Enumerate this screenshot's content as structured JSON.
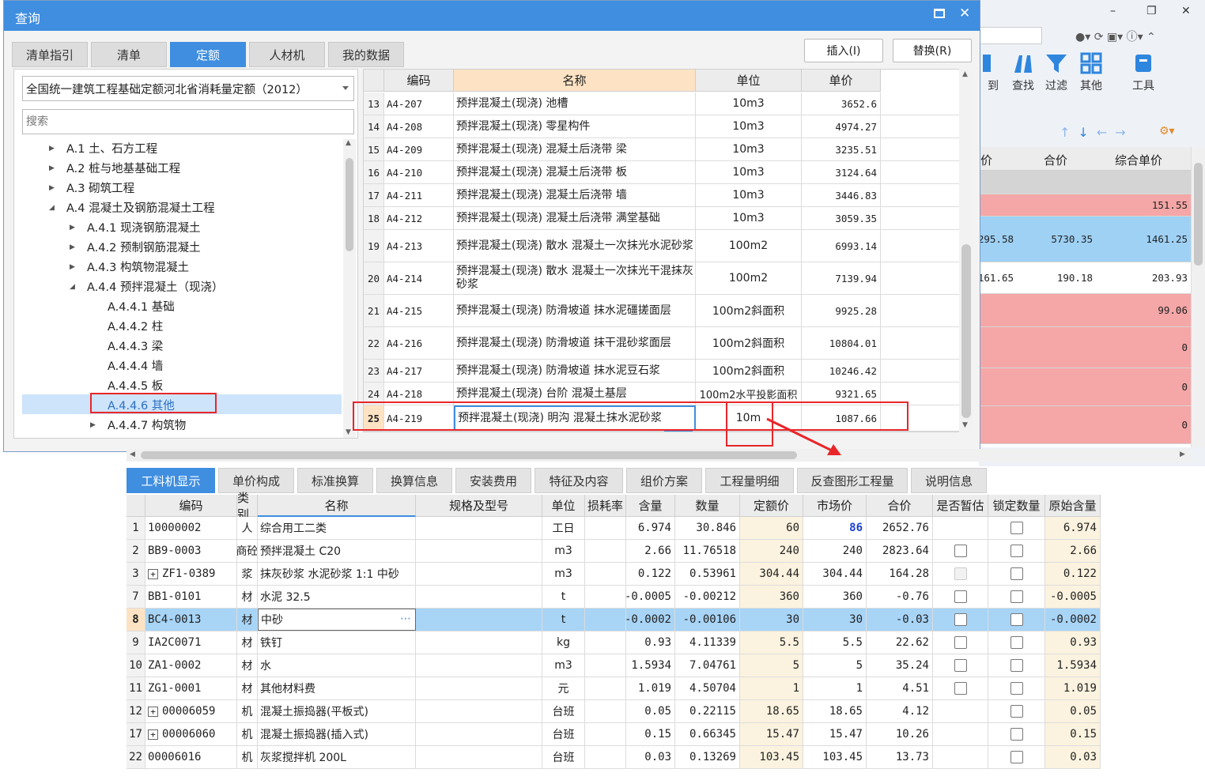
{
  "dialog": {
    "title": "查询",
    "tabs": [
      "清单指引",
      "清单",
      "定额",
      "人材机",
      "我的数据"
    ],
    "active_tab": "定额",
    "insert_btn": "插入(I)",
    "replace_btn": "替换(R)",
    "library": "全国统一建筑工程基础定额河北省消耗量定额（2012）",
    "search_placeholder": "搜索",
    "tree": [
      {
        "label": "A.1 土、石方工程",
        "level": 0,
        "state": "collapsed"
      },
      {
        "label": "A.2 桩与地基基础工程",
        "level": 0,
        "state": "collapsed"
      },
      {
        "label": "A.3 砌筑工程",
        "level": 0,
        "state": "collapsed"
      },
      {
        "label": "A.4 混凝土及钢筋混凝土工程",
        "level": 0,
        "state": "expanded"
      },
      {
        "label": "A.4.1 现浇钢筋混凝土",
        "level": 1,
        "state": "collapsed"
      },
      {
        "label": "A.4.2 预制钢筋混凝土",
        "level": 1,
        "state": "collapsed"
      },
      {
        "label": "A.4.3 构筑物混凝土",
        "level": 1,
        "state": "collapsed"
      },
      {
        "label": "A.4.4 预拌混凝土（现浇）",
        "level": 1,
        "state": "expanded"
      },
      {
        "label": "A.4.4.1 基础",
        "level": 2,
        "state": "leaf"
      },
      {
        "label": "A.4.4.2 柱",
        "level": 2,
        "state": "leaf"
      },
      {
        "label": "A.4.4.3 梁",
        "level": 2,
        "state": "leaf"
      },
      {
        "label": "A.4.4.4 墙",
        "level": 2,
        "state": "leaf"
      },
      {
        "label": "A.4.4.5 板",
        "level": 2,
        "state": "leaf"
      },
      {
        "label": "A.4.4.6 其他",
        "level": 2,
        "state": "selected"
      },
      {
        "label": "A.4.4.7 构筑物",
        "level": 2,
        "state": "collapsed"
      }
    ],
    "grid_headers": [
      "编码",
      "名称",
      "单位",
      "单价"
    ],
    "grid_rows": [
      {
        "no": "13",
        "code": "A4-207",
        "name": "预拌混凝土(现浇) 池槽",
        "unit": "10m3",
        "price": "3652.6"
      },
      {
        "no": "14",
        "code": "A4-208",
        "name": "预拌混凝土(现浇) 零星构件",
        "unit": "10m3",
        "price": "4974.27"
      },
      {
        "no": "15",
        "code": "A4-209",
        "name": "预拌混凝土(现浇) 混凝土后浇带 梁",
        "unit": "10m3",
        "price": "3235.51"
      },
      {
        "no": "16",
        "code": "A4-210",
        "name": "预拌混凝土(现浇) 混凝土后浇带 板",
        "unit": "10m3",
        "price": "3124.64"
      },
      {
        "no": "17",
        "code": "A4-211",
        "name": "预拌混凝土(现浇) 混凝土后浇带 墙",
        "unit": "10m3",
        "price": "3446.83"
      },
      {
        "no": "18",
        "code": "A4-212",
        "name": "预拌混凝土(现浇) 混凝土后浇带 满堂基础",
        "unit": "10m3",
        "price": "3059.35"
      },
      {
        "no": "19",
        "code": "A4-213",
        "name": "预拌混凝土(现浇) 散水 混凝土一次抹光水泥砂浆",
        "unit": "100m2",
        "price": "6993.14"
      },
      {
        "no": "20",
        "code": "A4-214",
        "name": "预拌混凝土(现浇) 散水 混凝土一次抹光干混抹灰砂浆",
        "unit": "100m2",
        "price": "7139.94"
      },
      {
        "no": "21",
        "code": "A4-215",
        "name": "预拌混凝土(现浇) 防滑坡道 抹水泥礓搓面层",
        "unit": "100m2斜面积",
        "price": "9925.28"
      },
      {
        "no": "22",
        "code": "A4-216",
        "name": "预拌混凝土(现浇) 防滑坡道 抹干混砂浆面层",
        "unit": "100m2斜面积",
        "price": "10804.01"
      },
      {
        "no": "23",
        "code": "A4-217",
        "name": "预拌混凝土(现浇) 防滑坡道 抹水泥豆石浆",
        "unit": "100m2斜面积",
        "price": "10246.42"
      },
      {
        "no": "24",
        "code": "A4-218",
        "name": "预拌混凝土(现浇) 台阶 混凝土基层",
        "unit": "100m2水平投影面积",
        "price": "9321.65"
      },
      {
        "no": "25",
        "code": "A4-219",
        "name": "预拌混凝土(现浇) 明沟 混凝土抹水泥砂浆",
        "unit": "10m",
        "price": "1087.66"
      }
    ]
  },
  "background": {
    "tools": [
      "到",
      "查找",
      "过滤",
      "其他",
      "工具"
    ],
    "headers": [
      "价",
      "合价",
      "综合单价"
    ],
    "rows": [
      {
        "a": "",
        "b": "",
        "c": "",
        "color": "#d4d4d4"
      },
      {
        "a": "",
        "b": "",
        "c": "151.55",
        "color": "#f5a6a6"
      },
      {
        "a": "295.58",
        "b": "5730.35",
        "c": "1461.25",
        "color": "#9fd1f5"
      },
      {
        "a": "161.65",
        "b": "190.18",
        "c": "203.93",
        "color": "#ffffff"
      },
      {
        "a": "",
        "b": "",
        "c": "99.06",
        "color": "#f5a6a6"
      },
      {
        "a": "",
        "b": "",
        "c": "0",
        "color": "#f5a6a6"
      },
      {
        "a": "",
        "b": "",
        "c": "0",
        "color": "#f5a6a6"
      },
      {
        "a": "",
        "b": "",
        "c": "0",
        "color": "#f5a6a6"
      }
    ]
  },
  "bottom": {
    "tabs": [
      "工料机显示",
      "单价构成",
      "标准换算",
      "换算信息",
      "安装费用",
      "特征及内容",
      "组价方案",
      "工程量明细",
      "反查图形工程量",
      "说明信息"
    ],
    "headers": [
      "编码",
      "类别",
      "名称",
      "规格及型号",
      "单位",
      "损耗率",
      "含量",
      "数量",
      "定额价",
      "市场价",
      "合价",
      "是否暂估",
      "锁定数量",
      "原始含量"
    ],
    "rows": [
      {
        "no": "1",
        "code": "10000002",
        "expand": false,
        "type": "人",
        "name": "综合用工二类",
        "spec": "",
        "unit": "工日",
        "loss": "",
        "qty": "6.974",
        "amount": "30.846",
        "quota": "60",
        "market": "86",
        "total": "2652.76",
        "est": "none",
        "lock": true,
        "orig": "6.974"
      },
      {
        "no": "2",
        "code": "BB9-0003",
        "expand": false,
        "type": "商砼",
        "name": "预拌混凝土 C20",
        "spec": "",
        "unit": "m3",
        "loss": "",
        "qty": "2.66",
        "amount": "11.76518",
        "quota": "240",
        "market": "240",
        "total": "2823.64",
        "est": "box",
        "lock": true,
        "orig": "2.66"
      },
      {
        "no": "3",
        "code": "ZF1-0389",
        "expand": true,
        "type": "浆",
        "name": "抹灰砂浆 水泥砂浆 1:1 中砂",
        "spec": "",
        "unit": "m3",
        "loss": "",
        "qty": "0.122",
        "amount": "0.53961",
        "quota": "304.44",
        "market": "304.44",
        "total": "164.28",
        "est": "disabled",
        "lock": true,
        "orig": "0.122"
      },
      {
        "no": "7",
        "code": "BB1-0101",
        "expand": false,
        "type": "材",
        "name": "水泥 32.5",
        "spec": "",
        "unit": "t",
        "loss": "",
        "qty": "-0.0005",
        "amount": "-0.00212",
        "quota": "360",
        "market": "360",
        "total": "-0.76",
        "est": "box",
        "lock": true,
        "orig": "-0.0005"
      },
      {
        "no": "8",
        "code": "BC4-0013",
        "expand": false,
        "type": "材",
        "name": "中砂",
        "spec": "",
        "unit": "t",
        "loss": "",
        "qty": "-0.0002",
        "amount": "-0.00106",
        "quota": "30",
        "market": "30",
        "total": "-0.03",
        "est": "box",
        "lock": true,
        "orig": "-0.0002"
      },
      {
        "no": "9",
        "code": "IA2C0071",
        "expand": false,
        "type": "材",
        "name": "铁钉",
        "spec": "",
        "unit": "kg",
        "loss": "",
        "qty": "0.93",
        "amount": "4.11339",
        "quota": "5.5",
        "market": "5.5",
        "total": "22.62",
        "est": "box",
        "lock": true,
        "orig": "0.93"
      },
      {
        "no": "10",
        "code": "ZA1-0002",
        "expand": false,
        "type": "材",
        "name": "水",
        "spec": "",
        "unit": "m3",
        "loss": "",
        "qty": "1.5934",
        "amount": "7.04761",
        "quota": "5",
        "market": "5",
        "total": "35.24",
        "est": "box",
        "lock": true,
        "orig": "1.5934"
      },
      {
        "no": "11",
        "code": "ZG1-0001",
        "expand": false,
        "type": "材",
        "name": "其他材料费",
        "spec": "",
        "unit": "元",
        "loss": "",
        "qty": "1.019",
        "amount": "4.50704",
        "quota": "1",
        "market": "1",
        "total": "4.51",
        "est": "box",
        "lock": true,
        "orig": "1.019"
      },
      {
        "no": "12",
        "code": "00006059",
        "expand": true,
        "type": "机",
        "name": "混凝土振捣器(平板式)",
        "spec": "",
        "unit": "台班",
        "loss": "",
        "qty": "0.05",
        "amount": "0.22115",
        "quota": "18.65",
        "market": "18.65",
        "total": "4.12",
        "est": "none",
        "lock": true,
        "orig": "0.05"
      },
      {
        "no": "17",
        "code": "00006060",
        "expand": true,
        "type": "机",
        "name": "混凝土振捣器(插入式)",
        "spec": "",
        "unit": "台班",
        "loss": "",
        "qty": "0.15",
        "amount": "0.66345",
        "quota": "15.47",
        "market": "15.47",
        "total": "10.26",
        "est": "none",
        "lock": true,
        "orig": "0.15"
      },
      {
        "no": "22",
        "code": "00006016",
        "expand": false,
        "type": "机",
        "name": "灰浆搅拌机 200L",
        "spec": "",
        "unit": "台班",
        "loss": "",
        "qty": "0.03",
        "amount": "0.13269",
        "quota": "103.45",
        "market": "103.45",
        "total": "13.73",
        "est": "none",
        "lock": true,
        "orig": "0.03"
      }
    ]
  },
  "colors": {
    "accent": "#3f8ee0",
    "highlight": "#e8262a",
    "market_blue": "#1a3fd8"
  }
}
